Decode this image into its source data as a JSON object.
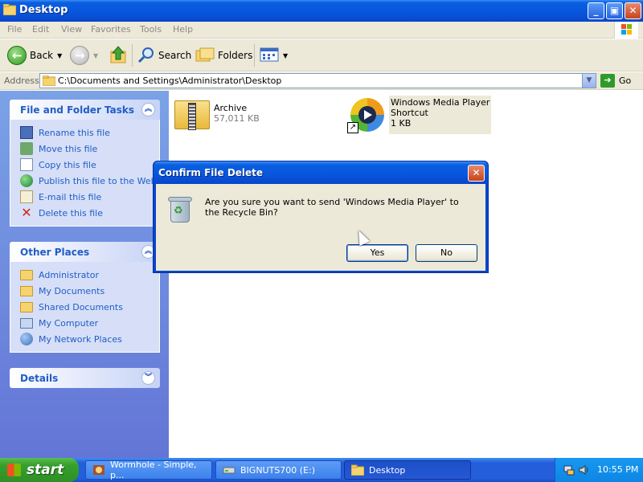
{
  "window": {
    "title": "Desktop",
    "controls": [
      "minimize",
      "maximize",
      "close"
    ]
  },
  "menu": [
    "File",
    "Edit",
    "View",
    "Favorites",
    "Tools",
    "Help"
  ],
  "toolbar": {
    "back_label": "Back",
    "search_label": "Search",
    "folders_label": "Folders"
  },
  "address": {
    "label": "Address",
    "path": "C:\\Documents and Settings\\Administrator\\Desktop",
    "go_label": "Go"
  },
  "sidebar": {
    "file_tasks": {
      "title": "File and Folder Tasks",
      "items": [
        {
          "label": "Rename this file",
          "icon": "rename-icon"
        },
        {
          "label": "Move this file",
          "icon": "move-icon"
        },
        {
          "label": "Copy this file",
          "icon": "copy-icon"
        },
        {
          "label": "Publish this file to the Web",
          "icon": "globe-icon"
        },
        {
          "label": "E-mail this file",
          "icon": "email-icon"
        },
        {
          "label": "Delete this file",
          "icon": "delete-icon"
        }
      ]
    },
    "other_places": {
      "title": "Other Places",
      "items": [
        {
          "label": "Administrator",
          "icon": "folder-icon"
        },
        {
          "label": "My Documents",
          "icon": "my-documents-icon"
        },
        {
          "label": "Shared Documents",
          "icon": "folder-icon"
        },
        {
          "label": "My Computer",
          "icon": "computer-icon"
        },
        {
          "label": "My Network Places",
          "icon": "network-icon"
        }
      ]
    },
    "details": {
      "title": "Details"
    }
  },
  "files": [
    {
      "name": "Archive",
      "sub": "57,011 KB",
      "icon": "zip-folder-icon"
    },
    {
      "name": "Windows Media Player",
      "name2": "Shortcut",
      "sub": "1 KB",
      "icon": "media-player-icon",
      "selected": true
    }
  ],
  "dialog": {
    "title": "Confirm File Delete",
    "message": "Are you sure you want to send 'Windows Media Player' to the Recycle Bin?",
    "yes_label": "Yes",
    "no_label": "No"
  },
  "taskbar": {
    "start_label": "start",
    "tasks": [
      {
        "label": "Wormhole - Simple, p..."
      },
      {
        "label": "BIGNUTS700 (E:)"
      },
      {
        "label": "Desktop",
        "active": true
      }
    ],
    "clock": "10:55 PM"
  },
  "colors": {
    "title_blue": "#0855dd",
    "sidebar_blue": "#6375d6",
    "link_blue": "#215dc6",
    "taskbar_blue": "#245edb",
    "start_green": "#35a02d"
  }
}
